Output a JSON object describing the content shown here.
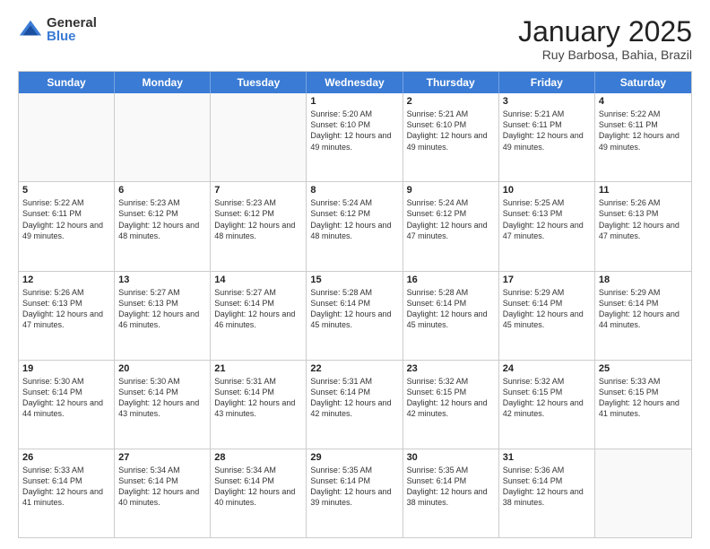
{
  "logo": {
    "general": "General",
    "blue": "Blue"
  },
  "header": {
    "month": "January 2025",
    "location": "Ruy Barbosa, Bahia, Brazil"
  },
  "days_of_week": [
    "Sunday",
    "Monday",
    "Tuesday",
    "Wednesday",
    "Thursday",
    "Friday",
    "Saturday"
  ],
  "weeks": [
    [
      {
        "day": "",
        "text": ""
      },
      {
        "day": "",
        "text": ""
      },
      {
        "day": "",
        "text": ""
      },
      {
        "day": "1",
        "text": "Sunrise: 5:20 AM\nSunset: 6:10 PM\nDaylight: 12 hours and 49 minutes."
      },
      {
        "day": "2",
        "text": "Sunrise: 5:21 AM\nSunset: 6:10 PM\nDaylight: 12 hours and 49 minutes."
      },
      {
        "day": "3",
        "text": "Sunrise: 5:21 AM\nSunset: 6:11 PM\nDaylight: 12 hours and 49 minutes."
      },
      {
        "day": "4",
        "text": "Sunrise: 5:22 AM\nSunset: 6:11 PM\nDaylight: 12 hours and 49 minutes."
      }
    ],
    [
      {
        "day": "5",
        "text": "Sunrise: 5:22 AM\nSunset: 6:11 PM\nDaylight: 12 hours and 49 minutes."
      },
      {
        "day": "6",
        "text": "Sunrise: 5:23 AM\nSunset: 6:12 PM\nDaylight: 12 hours and 48 minutes."
      },
      {
        "day": "7",
        "text": "Sunrise: 5:23 AM\nSunset: 6:12 PM\nDaylight: 12 hours and 48 minutes."
      },
      {
        "day": "8",
        "text": "Sunrise: 5:24 AM\nSunset: 6:12 PM\nDaylight: 12 hours and 48 minutes."
      },
      {
        "day": "9",
        "text": "Sunrise: 5:24 AM\nSunset: 6:12 PM\nDaylight: 12 hours and 47 minutes."
      },
      {
        "day": "10",
        "text": "Sunrise: 5:25 AM\nSunset: 6:13 PM\nDaylight: 12 hours and 47 minutes."
      },
      {
        "day": "11",
        "text": "Sunrise: 5:26 AM\nSunset: 6:13 PM\nDaylight: 12 hours and 47 minutes."
      }
    ],
    [
      {
        "day": "12",
        "text": "Sunrise: 5:26 AM\nSunset: 6:13 PM\nDaylight: 12 hours and 47 minutes."
      },
      {
        "day": "13",
        "text": "Sunrise: 5:27 AM\nSunset: 6:13 PM\nDaylight: 12 hours and 46 minutes."
      },
      {
        "day": "14",
        "text": "Sunrise: 5:27 AM\nSunset: 6:14 PM\nDaylight: 12 hours and 46 minutes."
      },
      {
        "day": "15",
        "text": "Sunrise: 5:28 AM\nSunset: 6:14 PM\nDaylight: 12 hours and 45 minutes."
      },
      {
        "day": "16",
        "text": "Sunrise: 5:28 AM\nSunset: 6:14 PM\nDaylight: 12 hours and 45 minutes."
      },
      {
        "day": "17",
        "text": "Sunrise: 5:29 AM\nSunset: 6:14 PM\nDaylight: 12 hours and 45 minutes."
      },
      {
        "day": "18",
        "text": "Sunrise: 5:29 AM\nSunset: 6:14 PM\nDaylight: 12 hours and 44 minutes."
      }
    ],
    [
      {
        "day": "19",
        "text": "Sunrise: 5:30 AM\nSunset: 6:14 PM\nDaylight: 12 hours and 44 minutes."
      },
      {
        "day": "20",
        "text": "Sunrise: 5:30 AM\nSunset: 6:14 PM\nDaylight: 12 hours and 43 minutes."
      },
      {
        "day": "21",
        "text": "Sunrise: 5:31 AM\nSunset: 6:14 PM\nDaylight: 12 hours and 43 minutes."
      },
      {
        "day": "22",
        "text": "Sunrise: 5:31 AM\nSunset: 6:14 PM\nDaylight: 12 hours and 42 minutes."
      },
      {
        "day": "23",
        "text": "Sunrise: 5:32 AM\nSunset: 6:15 PM\nDaylight: 12 hours and 42 minutes."
      },
      {
        "day": "24",
        "text": "Sunrise: 5:32 AM\nSunset: 6:15 PM\nDaylight: 12 hours and 42 minutes."
      },
      {
        "day": "25",
        "text": "Sunrise: 5:33 AM\nSunset: 6:15 PM\nDaylight: 12 hours and 41 minutes."
      }
    ],
    [
      {
        "day": "26",
        "text": "Sunrise: 5:33 AM\nSunset: 6:14 PM\nDaylight: 12 hours and 41 minutes."
      },
      {
        "day": "27",
        "text": "Sunrise: 5:34 AM\nSunset: 6:14 PM\nDaylight: 12 hours and 40 minutes."
      },
      {
        "day": "28",
        "text": "Sunrise: 5:34 AM\nSunset: 6:14 PM\nDaylight: 12 hours and 40 minutes."
      },
      {
        "day": "29",
        "text": "Sunrise: 5:35 AM\nSunset: 6:14 PM\nDaylight: 12 hours and 39 minutes."
      },
      {
        "day": "30",
        "text": "Sunrise: 5:35 AM\nSunset: 6:14 PM\nDaylight: 12 hours and 38 minutes."
      },
      {
        "day": "31",
        "text": "Sunrise: 5:36 AM\nSunset: 6:14 PM\nDaylight: 12 hours and 38 minutes."
      },
      {
        "day": "",
        "text": ""
      }
    ]
  ]
}
